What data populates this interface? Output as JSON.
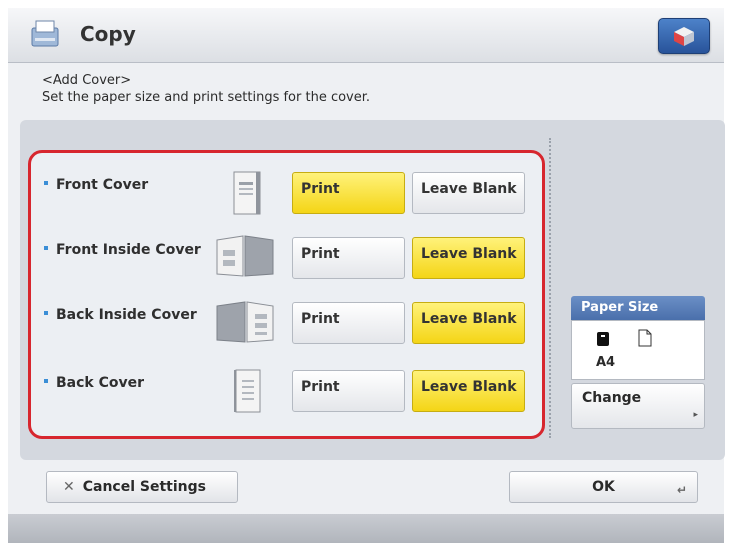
{
  "app": {
    "title": "Copy"
  },
  "header": {
    "line1": "<Add Cover>",
    "line2": "Set the paper size and print settings for the cover."
  },
  "rows": [
    {
      "label": "Front Cover",
      "print_label": "Print",
      "blank_label": "Leave Blank",
      "selected": "print"
    },
    {
      "label": "Front Inside Cover",
      "print_label": "Print",
      "blank_label": "Leave Blank",
      "selected": "blank"
    },
    {
      "label": "Back Inside Cover",
      "print_label": "Print",
      "blank_label": "Leave Blank",
      "selected": "blank"
    },
    {
      "label": "Back Cover",
      "print_label": "Print",
      "blank_label": "Leave Blank",
      "selected": "blank"
    }
  ],
  "paper": {
    "header": "Paper Size",
    "value": "A4",
    "change_label": "Change"
  },
  "footer_buttons": {
    "cancel": "Cancel Settings",
    "ok": "OK"
  },
  "colors": {
    "selected": "#f4d516",
    "highlight_border": "#d7262e",
    "accent": "#3a6fb5"
  }
}
